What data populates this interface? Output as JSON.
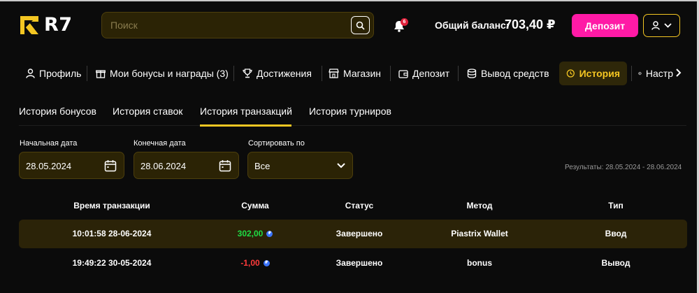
{
  "header": {
    "logo_text": "R7",
    "search_placeholder": "Поиск",
    "notification_count": "6",
    "balance_label": "Общий баланс:",
    "balance_value": "703,40 ₽",
    "deposit_label": "Депозит"
  },
  "nav": {
    "items": [
      {
        "label": "Профиль",
        "icon": "user-icon"
      },
      {
        "label": "Мои бонусы и награды (3)",
        "icon": "gift-icon"
      },
      {
        "label": "Достижения",
        "icon": "trophy-icon"
      },
      {
        "label": "Магазин",
        "icon": "shop-icon"
      },
      {
        "label": "Депозит",
        "icon": "wallet-icon"
      },
      {
        "label": "Вывод средств",
        "icon": "coins-icon"
      },
      {
        "label": "История",
        "icon": "history-icon",
        "active": true
      },
      {
        "label": "Настр",
        "icon": "gear-icon"
      }
    ]
  },
  "tabs": [
    {
      "label": "История бонусов"
    },
    {
      "label": "История ставок"
    },
    {
      "label": "История транзакций",
      "active": true
    },
    {
      "label": "История турниров"
    }
  ],
  "filters": {
    "start_label": "Начальная дата",
    "start_value": "28.05.2024",
    "end_label": "Конечная дата",
    "end_value": "28.06.2024",
    "sort_label": "Сортировать по",
    "sort_value": "Все",
    "results": "Результаты: 28.05.2024 - 28.06.2024"
  },
  "table": {
    "headers": [
      "Время транзакции",
      "Сумма",
      "Статус",
      "Метод",
      "Тип"
    ],
    "rows": [
      {
        "time": "10:01:58 28-06-2024",
        "amount": "302,00",
        "status": "Завершено",
        "method": "Piastrix Wallet",
        "type": "Ввод"
      },
      {
        "time": "19:49:22 30-05-2024",
        "amount": "-1,00",
        "status": "Завершено",
        "method": "bonus",
        "type": "Вывод"
      }
    ]
  },
  "colors": {
    "accent": "#f4c622",
    "deposit": "#ff1aa6",
    "positive": "#1fdc45",
    "negative": "#ff3b3b"
  }
}
